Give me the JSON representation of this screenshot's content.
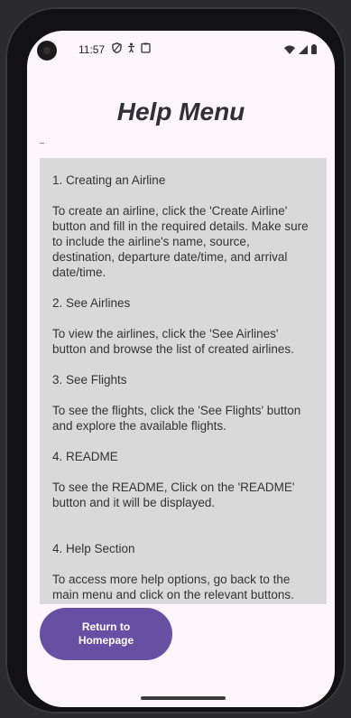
{
  "status_bar": {
    "time": "11:57",
    "left_icons": [
      "shield-icon",
      "accessibility-icon",
      "clipboard-icon"
    ],
    "right_icons": [
      "wifi-icon",
      "signal-icon",
      "battery-icon"
    ]
  },
  "page": {
    "title": "Help Menu"
  },
  "help_sections": [
    {
      "heading": "1. Creating an Airline",
      "body": "To create an airline, click the 'Create Airline' button and fill in the required details. Make sure to include the airline's name, source, destination, departure date/time, and arrival date/time."
    },
    {
      "heading": "2. See Airlines",
      "body": "To view the airlines, click the 'See Airlines' button and browse the list of created airlines."
    },
    {
      "heading": "3. See Flights",
      "body": "To see the flights, click the 'See Flights' button and explore the available flights."
    },
    {
      "heading": "4. README",
      "body": "To see the README, Click on the 'README' button and it will be displayed."
    },
    {
      "heading": "4. Help Section",
      "body": "To access more help options, go back to the main menu and click on the relevant buttons."
    }
  ],
  "return_button": {
    "label": "Return to Homepage"
  },
  "colors": {
    "background": "#fcf5fc",
    "panel": "#d9d9d9",
    "button": "#6750a4",
    "button_text": "#ffffff"
  }
}
